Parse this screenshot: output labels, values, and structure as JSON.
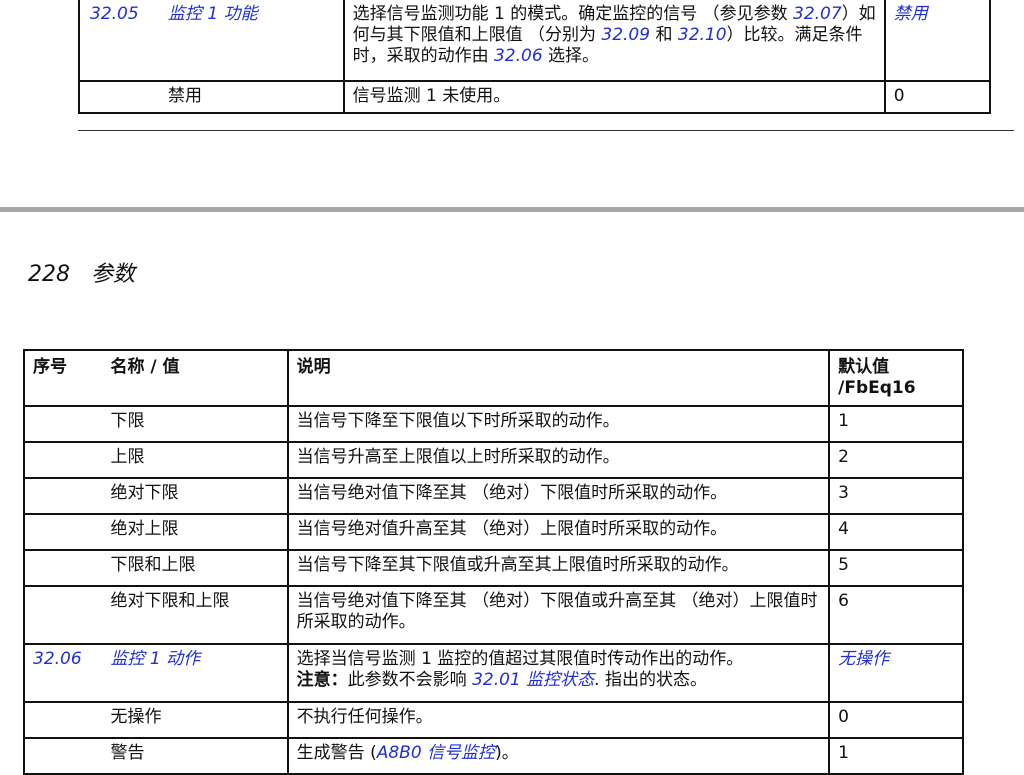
{
  "top_table": {
    "row1": {
      "number": "32.05",
      "name": "监控 1 功能",
      "desc_parts": [
        "选择信号监测功能 1 的模式。确定监控的信号 （参见参数 ",
        "32.07",
        "）如何与其下限值和上限值 （分别为 ",
        "32.09",
        " 和 ",
        "32.10",
        "）比较。满足条件时，采取的动作由 ",
        "32.06",
        " 选择。"
      ],
      "default": "禁用"
    },
    "row2": {
      "name": "禁用",
      "desc": "信号监测 1 未使用。",
      "default": "0"
    }
  },
  "page_header": {
    "page_number": "228",
    "section": "参数"
  },
  "main_table": {
    "headers": {
      "number": "序号",
      "name": "名称 / 值",
      "desc": "说明",
      "default_line1": "默认值",
      "default_line2": "/FbEq16"
    },
    "rows": [
      {
        "name": "下限",
        "desc": "当信号下降至下限值以下时所采取的动作。",
        "default": "1"
      },
      {
        "name": "上限",
        "desc": "当信号升高至上限值以上时所采取的动作。",
        "default": "2"
      },
      {
        "name": "绝对下限",
        "desc": "当信号绝对值下降至其 （绝对）下限值时所采取的动作。",
        "default": "3"
      },
      {
        "name": "绝对上限",
        "desc": "当信号绝对值升高至其 （绝对）上限值时所采取的动作。",
        "default": "4"
      },
      {
        "name": "下限和上限",
        "desc": "当信号下降至其下限值或升高至其上限值时所采取的动作。",
        "default": "5"
      },
      {
        "name": "绝对下限和上限",
        "desc": "当信号绝对值下降至其 （绝对）下限值或升高至其 （绝对）上限值时所采取的动作。",
        "default": "6"
      }
    ],
    "param_row": {
      "number": "32.06",
      "name": "监控 1 动作",
      "desc": "选择当信号监测 1 监控的值超过其限值时传动作出的动作。",
      "note_label": "注意：",
      "note_text": "此参数不会影响 ",
      "note_ref_number": "32.01",
      "note_ref_name": "监控状态",
      "note_tail": ". 指出的状态。",
      "default": "无操作"
    },
    "rows2": [
      {
        "name": "无操作",
        "desc": "不执行任何操作。",
        "default": "0"
      },
      {
        "name": "警告",
        "desc_prefix": "生成警告 (",
        "desc_ref_code": "A8B0",
        "desc_ref_name": "信号监控",
        "desc_suffix": ")。",
        "default": "1"
      }
    ]
  }
}
